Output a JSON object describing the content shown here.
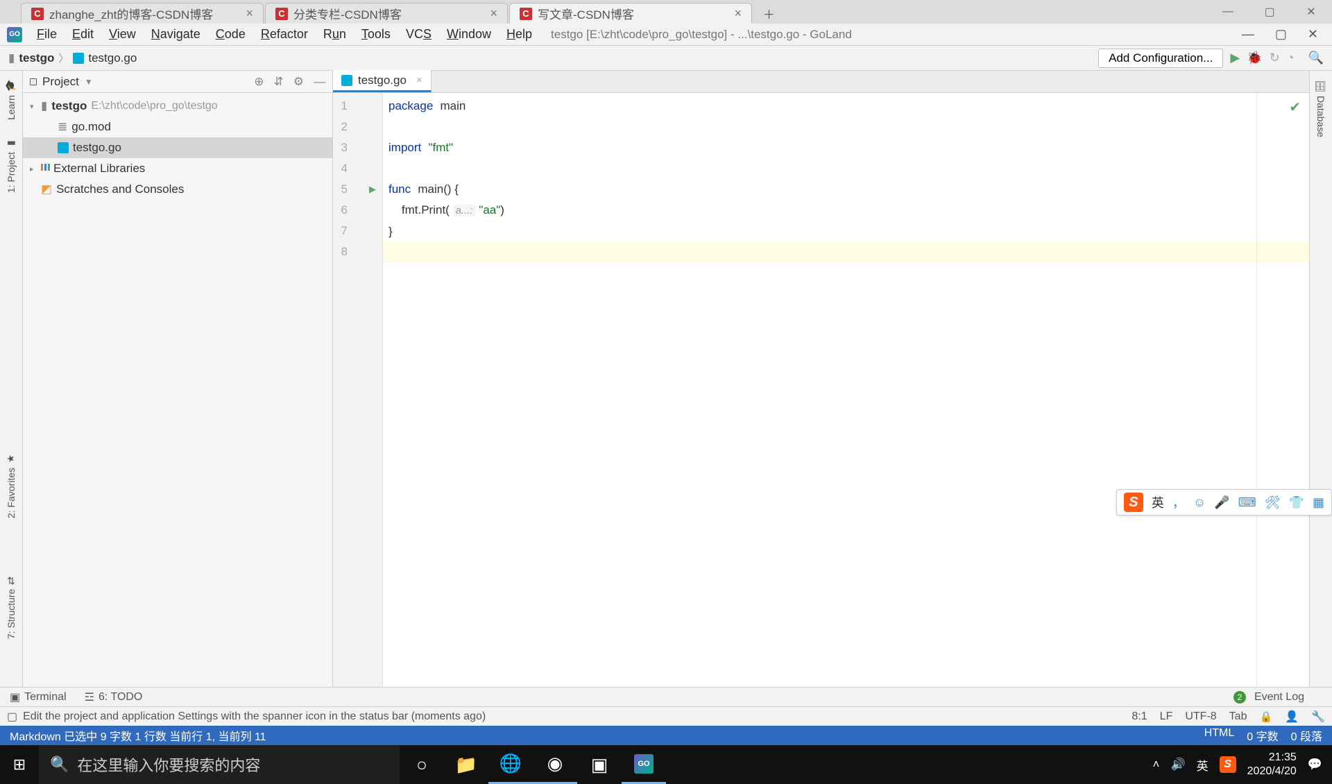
{
  "browser": {
    "tabs": [
      {
        "title": "zhanghe_zht的博客-CSDN博客"
      },
      {
        "title": "分类专栏-CSDN博客"
      },
      {
        "title": "写文章-CSDN博客"
      }
    ]
  },
  "ide": {
    "menu": {
      "file": "File",
      "edit": "Edit",
      "view": "View",
      "navigate": "Navigate",
      "code": "Code",
      "refactor": "Refactor",
      "run": "Run",
      "tools": "Tools",
      "vcs": "VCS",
      "window": "Window",
      "help": "Help"
    },
    "title": "testgo [E:\\zht\\code\\pro_go\\testgo] - ...\\testgo.go - GoLand",
    "breadcrumb": {
      "root": "testgo",
      "file": "testgo.go"
    },
    "add_config": "Add Configuration..."
  },
  "project": {
    "label": "Project",
    "root": {
      "name": "testgo",
      "path": "E:\\zht\\code\\pro_go\\testgo"
    },
    "files": {
      "gomod": "go.mod",
      "testgo": "testgo.go"
    },
    "external": "External Libraries",
    "scratches": "Scratches and Consoles"
  },
  "left_tabs": {
    "learn": "Learn",
    "project": "1: Project",
    "favorites": "2: Favorites",
    "structure": "7: Structure"
  },
  "right_tabs": {
    "database": "Database"
  },
  "editor": {
    "tab": "testgo.go",
    "lines": [
      "1",
      "2",
      "3",
      "4",
      "5",
      "6",
      "7",
      "8"
    ],
    "code": {
      "l1_kw": "package",
      "l1_id": "main",
      "l3_kw": "import",
      "l3_str": "\"fmt\"",
      "l5_kw": "func",
      "l5_name": "main()",
      "l5_brace": " {",
      "l6_call_pre": "    fmt.Print( ",
      "l6_hint": "a...:",
      "l6_str": " \"aa\"",
      "l6_call_post": ")",
      "l7": "}"
    }
  },
  "bottom": {
    "terminal": "Terminal",
    "todo": "6: TODO",
    "event_log": "Event Log",
    "event_count": "2"
  },
  "status": {
    "msg": "Edit the project and application Settings with the spanner icon in the status bar (moments ago)",
    "pos": "8:1",
    "lf": "LF",
    "enc": "UTF-8",
    "indent": "Tab"
  },
  "app_status": {
    "left": "Markdown 已选中  9 字数  1 行数  当前行 1, 当前列 11",
    "right_html": "HTML",
    "right_words": "0 字数",
    "right_para": "0 段落"
  },
  "ime": {
    "lang": "英",
    "comma": "，"
  },
  "taskbar": {
    "search_placeholder": "在这里输入你要搜索的内容",
    "lang": "英",
    "time": "21:35",
    "date": "2020/4/20"
  }
}
